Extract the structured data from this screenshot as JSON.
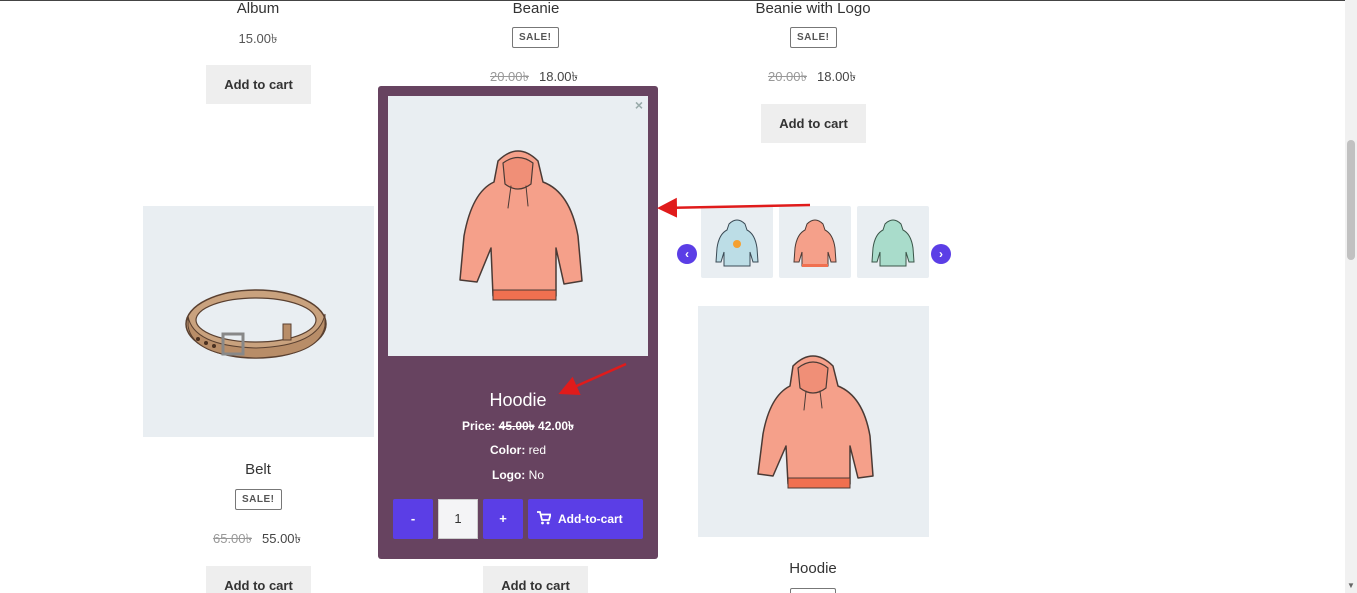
{
  "products": {
    "album": {
      "title": "Album",
      "price": "15.00৳",
      "button": "Add to cart"
    },
    "beanie": {
      "title": "Beanie",
      "sale": "SALE!",
      "old_price": "20.00৳",
      "price": "18.00৳"
    },
    "beanie_logo": {
      "title": "Beanie with Logo",
      "sale": "SALE!",
      "old_price": "20.00৳",
      "price": "18.00৳",
      "button": "Add to cart"
    },
    "belt": {
      "title": "Belt",
      "sale": "SALE!",
      "old_price": "65.00৳",
      "price": "55.00৳",
      "button": "Add to cart"
    },
    "hidden_item": {
      "button": "Add to cart"
    },
    "hoodie": {
      "title": "Hoodie"
    }
  },
  "modal": {
    "close": "×",
    "title": "Hoodie",
    "price_label": "Price:",
    "old_price": "45.00৳",
    "price": "42.00৳",
    "color_label": "Color:",
    "color_value": "red",
    "logo_label": "Logo:",
    "logo_value": "No",
    "minus": "-",
    "quantity": "1",
    "plus": "+",
    "add_to_cart": "Add-to-cart"
  },
  "carousel": {
    "prev": "‹",
    "next": "›",
    "variants": [
      "blue-hoodie-with-logo",
      "red-hoodie",
      "green-hoodie"
    ]
  },
  "colors": {
    "modal_bg": "#674360",
    "accent": "#5b3ee6",
    "annotation_arrow": "#e01b1b",
    "image_bg": "#e9eef2"
  }
}
